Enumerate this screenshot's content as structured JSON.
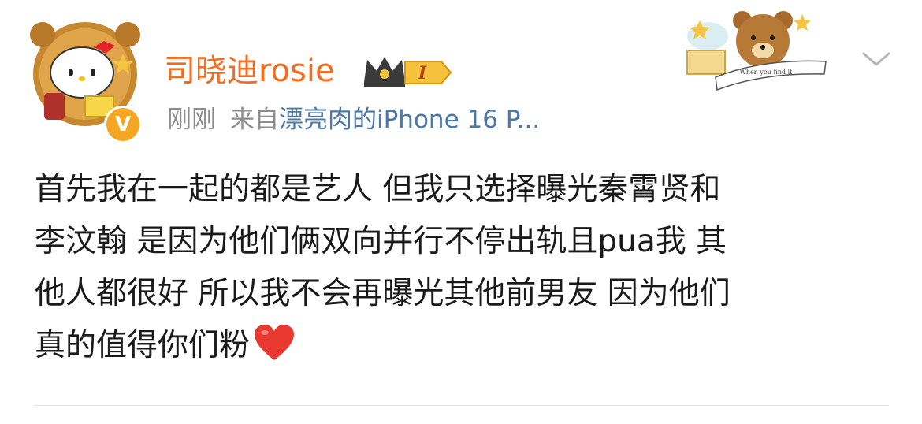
{
  "post": {
    "username": "司晓迪rosie",
    "vip_level": "I",
    "time": "刚刚",
    "source_prefix": "来自",
    "source_device": "漂亮肉的iPhone 16 P...",
    "verified_mark": "V",
    "content_lines": [
      "首先我在一起的都是艺人 但我只选择曝光秦霄贤和",
      "李汶翰 是因为他们俩双向并行不停出轨且pua我 其",
      "他人都很好 所以我不会再曝光其他前男友 因为他们",
      "真的值得你们粉"
    ],
    "banner_text": "When you find it",
    "emoji": "heart-emoji"
  },
  "colors": {
    "username": "#f26d20",
    "meta": "#8c8c8c",
    "source_link": "#4a78a8",
    "text": "#1a1a1a",
    "badge": "#f5a623",
    "heart": "#e8382f"
  }
}
